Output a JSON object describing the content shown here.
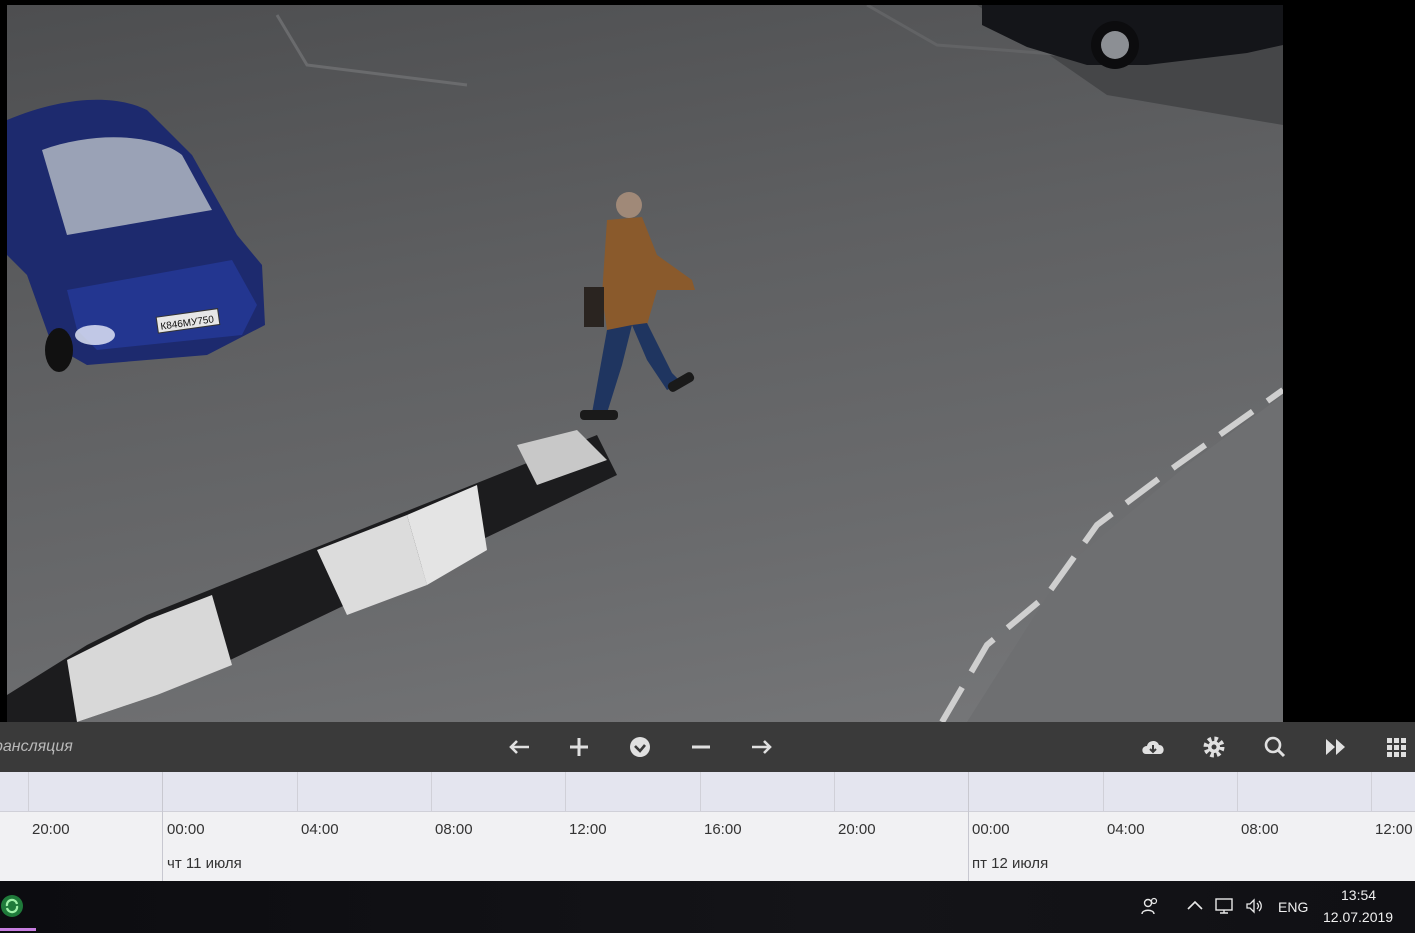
{
  "video": {
    "plate": "К846МУ750"
  },
  "controls": {
    "mode_label": "рансляция",
    "buttons": [
      {
        "icon": "arrow-left-icon"
      },
      {
        "icon": "plus-icon"
      },
      {
        "icon": "check-circle-icon"
      },
      {
        "icon": "minus-icon"
      },
      {
        "icon": "arrow-right-icon"
      },
      {
        "icon": "cloud-download-icon"
      },
      {
        "icon": "gear-icon"
      },
      {
        "icon": "search-icon"
      },
      {
        "icon": "fast-forward-icon"
      },
      {
        "icon": "grid-icon"
      }
    ]
  },
  "timeline": {
    "hours": [
      "20:00",
      "00:00",
      "04:00",
      "08:00",
      "12:00",
      "16:00",
      "20:00",
      "00:00",
      "04:00",
      "08:00",
      "12:00"
    ],
    "days": [
      "чт 11 июля",
      "пт 12 июля"
    ]
  },
  "taskbar": {
    "lang": "ENG",
    "time": "13:54",
    "date": "12.07.2019"
  },
  "colors": {
    "control_bar": "#3a3a3a",
    "timeline_bg": "#f1f1f3",
    "timeline_top": "#e4e5ef",
    "taskbar_bg": "#0c0c10",
    "app_accent": "#c77ee0"
  }
}
